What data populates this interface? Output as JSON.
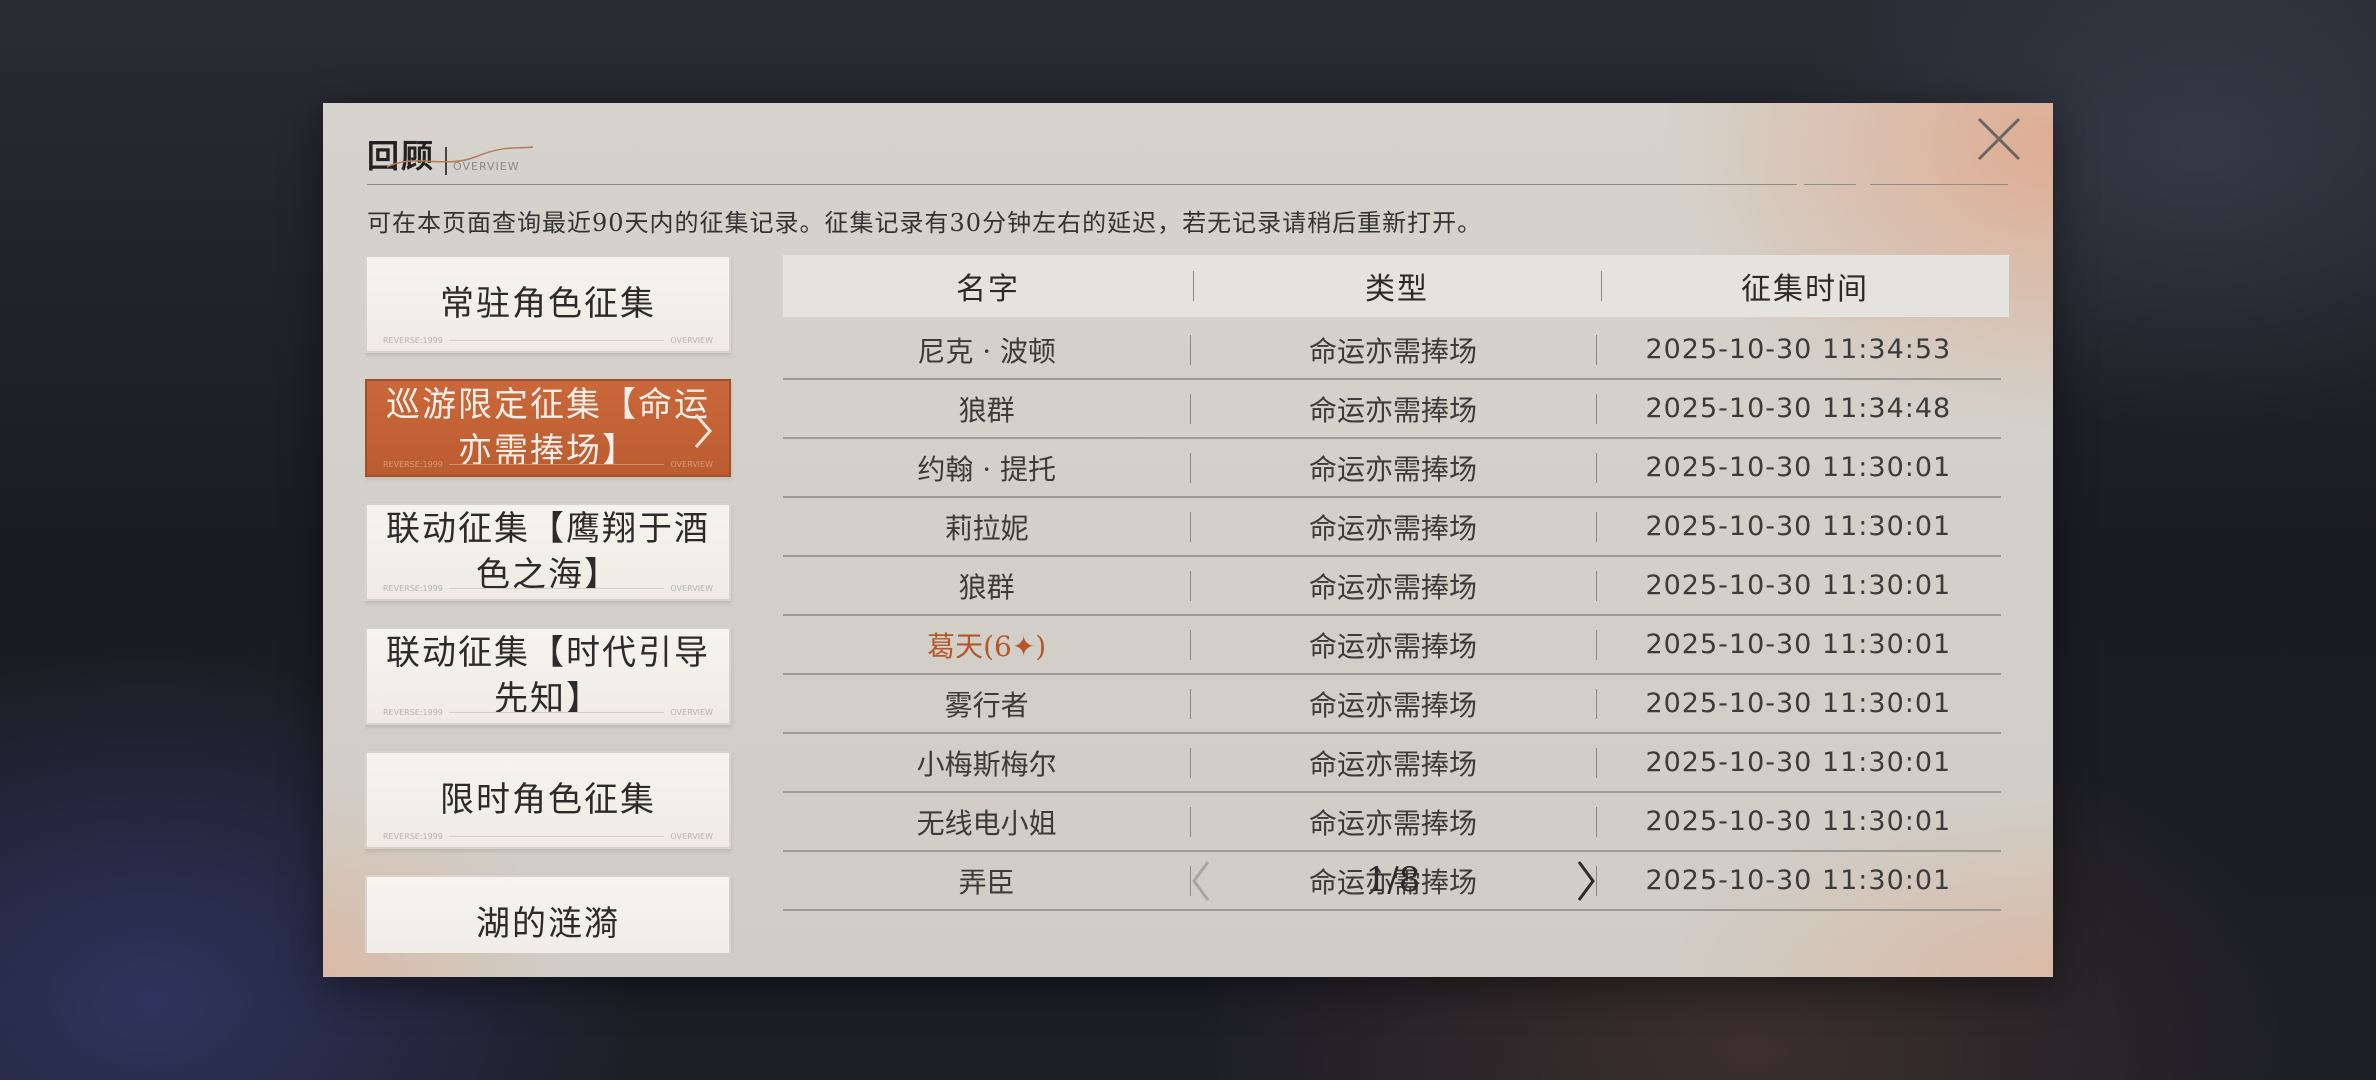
{
  "header": {
    "title": "回顾",
    "subtitle": "OVERVIEW",
    "notice": "可在本页面查询最近90天内的征集记录。征集记录有30分钟左右的延迟，若无记录请稍后重新打开。"
  },
  "sidebar": {
    "items": [
      {
        "label": "常驻角色征集",
        "active": false
      },
      {
        "label": "巡游限定征集【命运亦需捧场】",
        "active": true
      },
      {
        "label": "联动征集【鹰翔于酒色之海】",
        "active": false
      },
      {
        "label": "联动征集【时代引导先知】",
        "active": false
      },
      {
        "label": "限时角色征集",
        "active": false
      },
      {
        "label": "湖的涟漪",
        "active": false
      }
    ],
    "deco_left": "REVERSE:1999",
    "deco_right": "OVERVIEW"
  },
  "table": {
    "headers": [
      "名字",
      "类型",
      "征集时间"
    ],
    "rows": [
      {
        "name": "尼克 · 波顿",
        "type": "命运亦需捧场",
        "time": "2025-10-30 11:34:53"
      },
      {
        "name": "狼群",
        "type": "命运亦需捧场",
        "time": "2025-10-30 11:34:48"
      },
      {
        "name": "约翰 · 提托",
        "type": "命运亦需捧场",
        "time": "2025-10-30 11:30:01"
      },
      {
        "name": "莉拉妮",
        "type": "命运亦需捧场",
        "time": "2025-10-30 11:30:01"
      },
      {
        "name": "狼群",
        "type": "命运亦需捧场",
        "time": "2025-10-30 11:30:01"
      },
      {
        "name": "葛天(6✦)",
        "type": "命运亦需捧场",
        "time": "2025-10-30 11:30:01"
      },
      {
        "name": "雾行者",
        "type": "命运亦需捧场",
        "time": "2025-10-30 11:30:01"
      },
      {
        "name": "小梅斯梅尔",
        "type": "命运亦需捧场",
        "time": "2025-10-30 11:30:01"
      },
      {
        "name": "无线电小姐",
        "type": "命运亦需捧场",
        "time": "2025-10-30 11:30:01"
      },
      {
        "name": "弄臣",
        "type": "命运亦需捧场",
        "time": "2025-10-30 11:30:01"
      }
    ],
    "highlight_color": "#b4582a"
  },
  "pager": {
    "text": "1/8"
  },
  "colors": {
    "accent": "#c2643a",
    "panel": "#d2d0c9"
  }
}
